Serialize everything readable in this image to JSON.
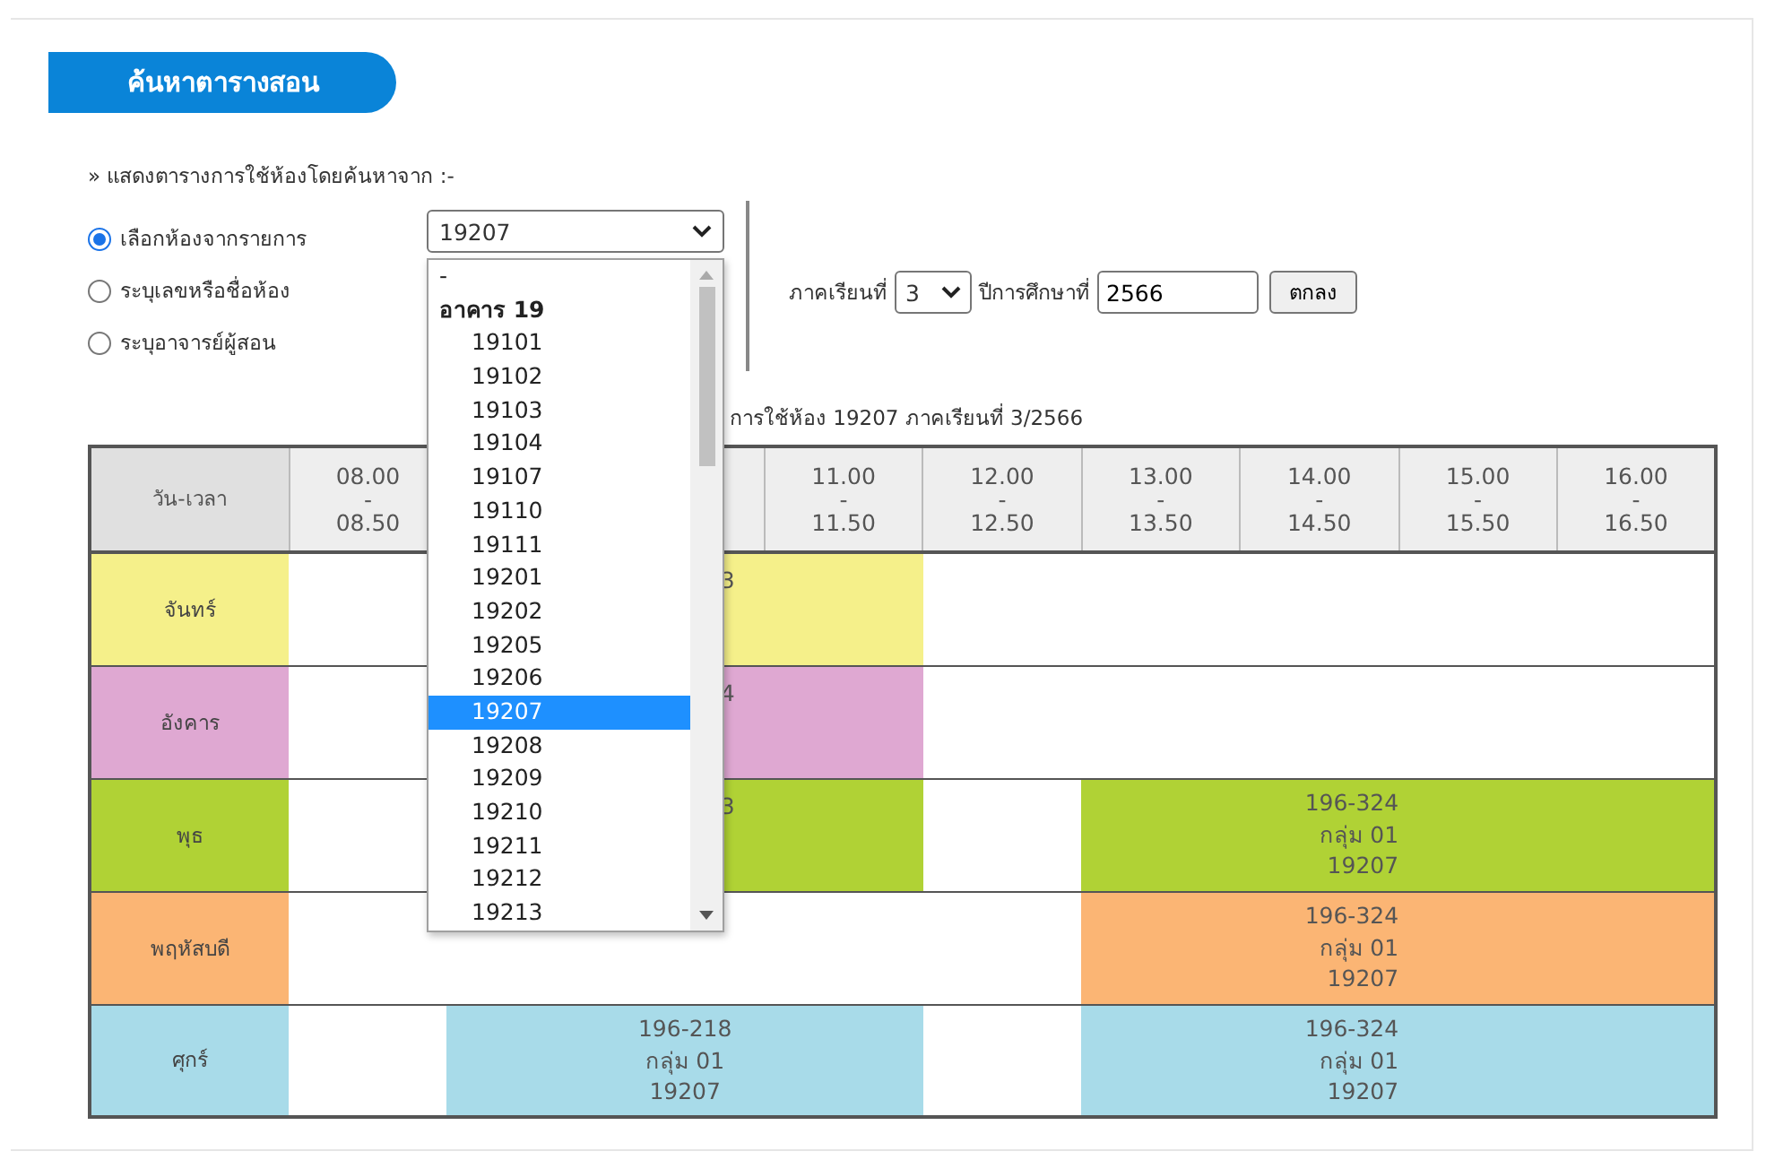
{
  "title": "ค้นหาตารางสอน",
  "intro": "» แสดงตารางการใช้ห้องโดยค้นหาจาก :-",
  "search_options": [
    {
      "label": "เลือกห้องจากรายการ",
      "selected": true
    },
    {
      "label": "ระบุเลขหรือชื่อห้อง",
      "selected": false
    },
    {
      "label": "ระบุอาจารย์ผู้สอน",
      "selected": false
    }
  ],
  "room_select": {
    "value": "19207",
    "options": [
      {
        "kind": "option",
        "label": "-",
        "selected": false
      },
      {
        "kind": "group",
        "label": "อาคาร 19"
      },
      {
        "kind": "option",
        "label": "19101",
        "selected": false
      },
      {
        "kind": "option",
        "label": "19102",
        "selected": false
      },
      {
        "kind": "option",
        "label": "19103",
        "selected": false
      },
      {
        "kind": "option",
        "label": "19104",
        "selected": false
      },
      {
        "kind": "option",
        "label": "19107",
        "selected": false
      },
      {
        "kind": "option",
        "label": "19110",
        "selected": false
      },
      {
        "kind": "option",
        "label": "19111",
        "selected": false
      },
      {
        "kind": "option",
        "label": "19201",
        "selected": false
      },
      {
        "kind": "option",
        "label": "19202",
        "selected": false
      },
      {
        "kind": "option",
        "label": "19205",
        "selected": false
      },
      {
        "kind": "option",
        "label": "19206",
        "selected": false
      },
      {
        "kind": "option",
        "label": "19207",
        "selected": true
      },
      {
        "kind": "option",
        "label": "19208",
        "selected": false
      },
      {
        "kind": "option",
        "label": "19209",
        "selected": false
      },
      {
        "kind": "option",
        "label": "19210",
        "selected": false
      },
      {
        "kind": "option",
        "label": "19211",
        "selected": false
      },
      {
        "kind": "option",
        "label": "19212",
        "selected": false
      },
      {
        "kind": "option",
        "label": "19213",
        "selected": false
      }
    ]
  },
  "semester": {
    "label": "ภาคเรียนที่",
    "value": "3"
  },
  "year": {
    "label": "ปีการศึกษาที่",
    "value": "2566"
  },
  "submit_button": "ตกลง",
  "caption": "การใช้ห้อง 19207 ภาคเรียนที่ 3/2566",
  "table": {
    "corner": "วัน-เวลา",
    "columns": [
      {
        "start": "08.00",
        "sep": "-",
        "end": "08.50"
      },
      {},
      {},
      {
        "start": "11.00",
        "sep": "-",
        "end": "11.50"
      },
      {
        "start": "12.00",
        "sep": "-",
        "end": "12.50"
      },
      {
        "start": "13.00",
        "sep": "-",
        "end": "13.50"
      },
      {
        "start": "14.00",
        "sep": "-",
        "end": "14.50"
      },
      {
        "start": "15.00",
        "sep": "-",
        "end": "15.50"
      },
      {
        "start": "16.00",
        "sep": "-",
        "end": "16.50"
      }
    ],
    "rows": [
      {
        "day": "จันทร์",
        "color": "#f5f08a",
        "cells": [
          {
            "booked": false
          },
          {},
          {
            "booked": true,
            "kind": "partial",
            "lines": [
              "3"
            ]
          },
          {
            "booked": true
          },
          {
            "booked": false
          },
          {
            "booked": false
          },
          {
            "booked": false
          },
          {
            "booked": false
          },
          {
            "booked": false
          }
        ]
      },
      {
        "day": "อังคาร",
        "color": "#dfa8d2",
        "cells": [
          {
            "booked": false
          },
          {},
          {
            "booked": true,
            "kind": "partial",
            "lines": [
              "4"
            ]
          },
          {
            "booked": true
          },
          {
            "booked": false
          },
          {
            "booked": false
          },
          {
            "booked": false
          },
          {
            "booked": false
          },
          {
            "booked": false
          }
        ]
      },
      {
        "day": "พุธ",
        "color": "#b0d235",
        "cells": [
          {
            "booked": false
          },
          {},
          {
            "booked": true,
            "kind": "partial",
            "lines": [
              "3"
            ]
          },
          {
            "booked": true
          },
          {
            "booked": false
          },
          {
            "booked": true
          },
          {
            "booked": true,
            "kind": "class",
            "lines": [
              "196-324",
              "กลุ่ม 01",
              "19207"
            ]
          },
          {
            "booked": true
          },
          {
            "booked": true
          }
        ]
      },
      {
        "day": "พฤหัสบดี",
        "color": "#fbb574",
        "cells": [
          {
            "booked": false
          },
          {
            "booked": false
          },
          {
            "booked": false
          },
          {
            "booked": false
          },
          {
            "booked": false
          },
          {
            "booked": true
          },
          {
            "booked": true,
            "kind": "class",
            "lines": [
              "196-324",
              "กลุ่ม 01",
              "19207"
            ]
          },
          {
            "booked": true
          },
          {
            "booked": true
          }
        ]
      },
      {
        "day": "ศุกร์",
        "color": "#a8dbe9",
        "cells": [
          {
            "booked": false
          },
          {
            "booked": true
          },
          {
            "booked": true,
            "kind": "class",
            "lines": [
              "196-218",
              "กลุ่ม 01",
              "19207"
            ]
          },
          {
            "booked": true
          },
          {
            "booked": false
          },
          {
            "booked": true
          },
          {
            "booked": true,
            "kind": "class",
            "lines": [
              "196-324",
              "กลุ่ม 01",
              "19207"
            ]
          },
          {
            "booked": true
          },
          {
            "booked": true
          }
        ]
      }
    ]
  }
}
